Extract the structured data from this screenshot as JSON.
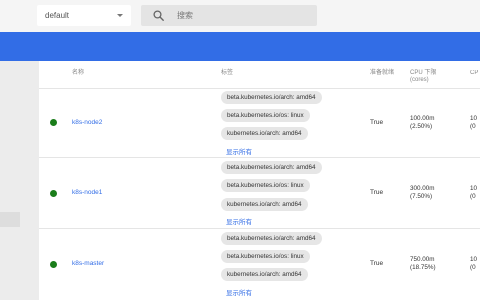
{
  "toolbar": {
    "namespace": "default",
    "search_placeholder": "搜索"
  },
  "table": {
    "headers": {
      "name": "名称",
      "labels": "标签",
      "ready": "准备就绪",
      "cpu_requests_line1": "CPU 下限",
      "cpu_requests_line2": "(cores)",
      "cpu_limits": "CP"
    },
    "show_all": "显示所有",
    "rows": [
      {
        "name": "k8s-node2",
        "labels": [
          "beta.kubernetes.io/arch: amd64",
          "beta.kubernetes.io/os: linux",
          "kubernetes.io/arch: amd64"
        ],
        "ready": "True",
        "cpu_requests": "100.00m",
        "cpu_requests_pct": "(2.50%)",
        "cpu_limits_partial_1": "10",
        "cpu_limits_partial_2": "(0"
      },
      {
        "name": "k8s-node1",
        "labels": [
          "beta.kubernetes.io/arch: amd64",
          "beta.kubernetes.io/os: linux",
          "kubernetes.io/arch: amd64"
        ],
        "ready": "True",
        "cpu_requests": "300.00m",
        "cpu_requests_pct": "(7.50%)",
        "cpu_limits_partial_1": "10",
        "cpu_limits_partial_2": "(0"
      },
      {
        "name": "k8s-master",
        "labels": [
          "beta.kubernetes.io/arch: amd64",
          "beta.kubernetes.io/os: linux",
          "kubernetes.io/arch: amd64"
        ],
        "ready": "True",
        "cpu_requests": "750.00m",
        "cpu_requests_pct": "(18.75%)",
        "cpu_limits_partial_1": "10",
        "cpu_limits_partial_2": "(0"
      }
    ]
  },
  "colors": {
    "brand": "#326de6",
    "status_ok": "#1a7d1a",
    "chip_bg": "#e6e6e6"
  }
}
